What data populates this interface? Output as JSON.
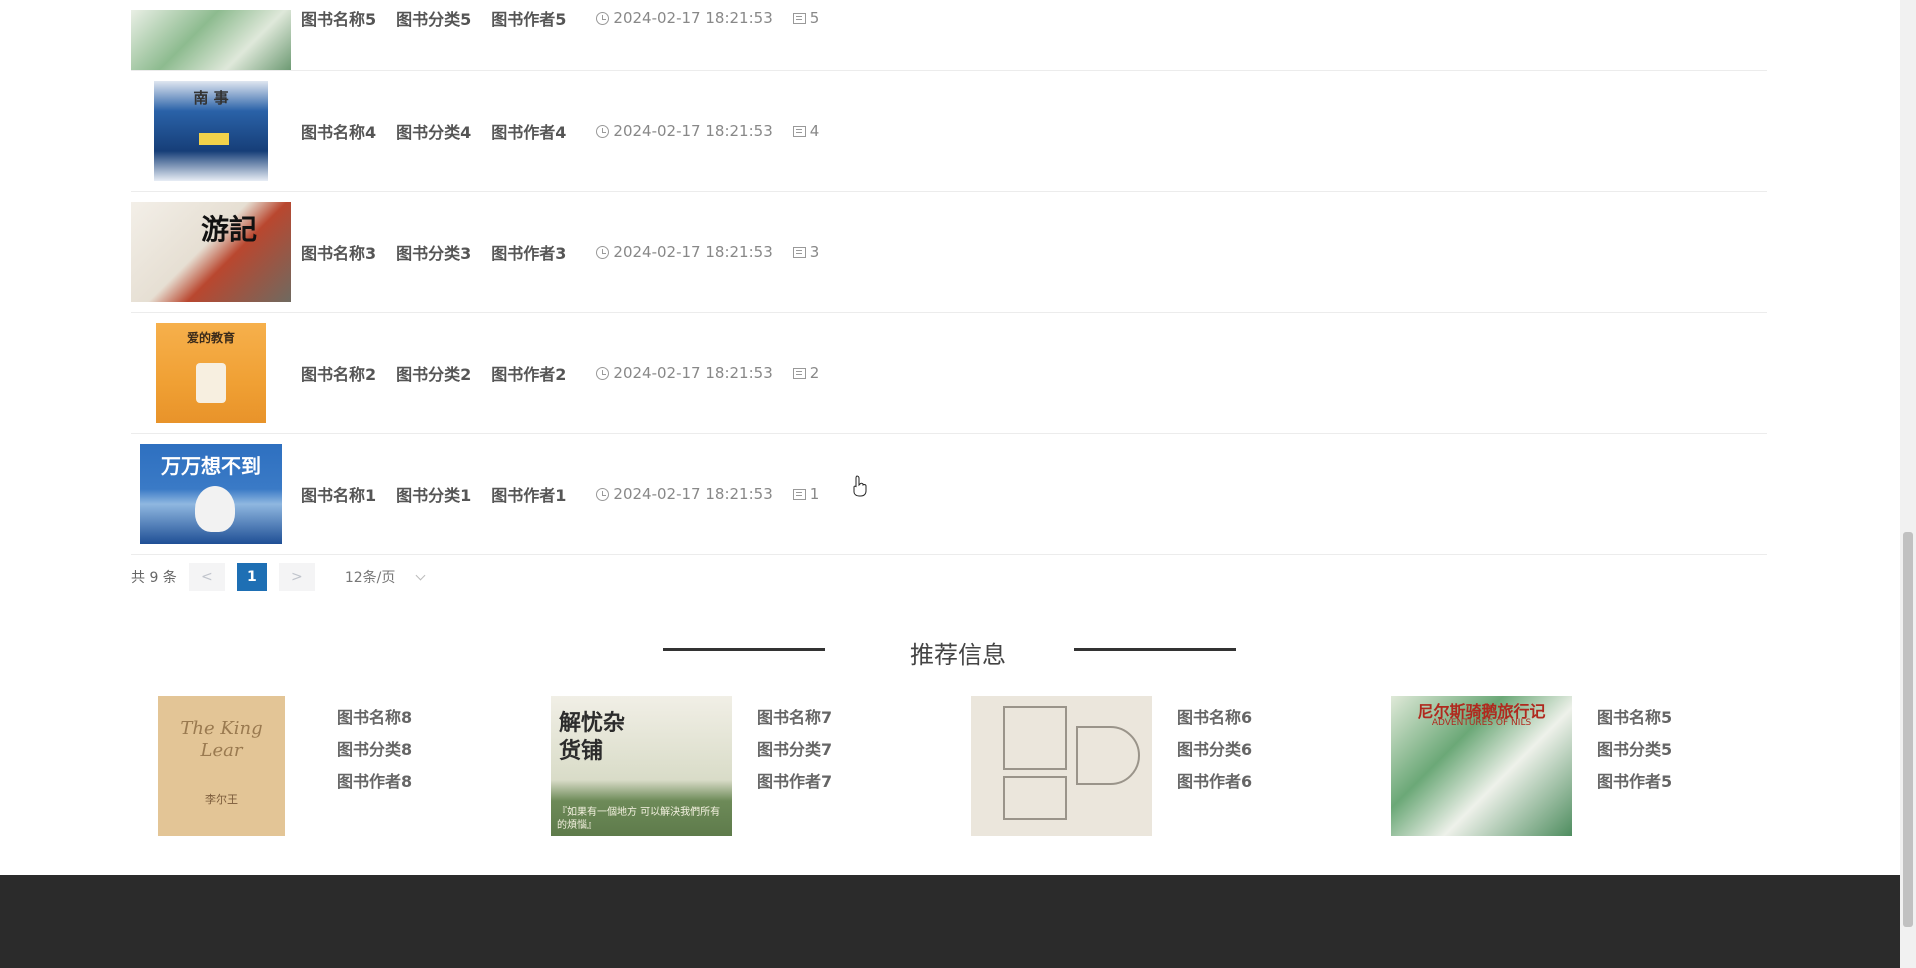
{
  "list": [
    {
      "name": "图书名称5",
      "category": "图书分类5",
      "author": "图书作者5",
      "time": "2024-02-17 18:21:53",
      "count": "5",
      "cover_text": "",
      "cover_color": "#6ea37a"
    },
    {
      "name": "图书名称4",
      "category": "图书分类4",
      "author": "图书作者4",
      "time": "2024-02-17 18:21:53",
      "count": "4",
      "cover_text": "南 事",
      "cover_color": "#1c4f8f"
    },
    {
      "name": "图书名称3",
      "category": "图书分类3",
      "author": "图书作者3",
      "time": "2024-02-17 18:21:53",
      "count": "3",
      "cover_text": "游記",
      "cover_color": "#e8e4dc"
    },
    {
      "name": "图书名称2",
      "category": "图书分类2",
      "author": "图书作者2",
      "time": "2024-02-17 18:21:53",
      "count": "2",
      "cover_text": "爱的教育",
      "cover_color": "#f0a63c"
    },
    {
      "name": "图书名称1",
      "category": "图书分类1",
      "author": "图书作者1",
      "time": "2024-02-17 18:21:53",
      "count": "1",
      "cover_text": "万万想不到",
      "cover_color": "#2d6cb8"
    }
  ],
  "pager": {
    "total": "共 9 条",
    "prev": "<",
    "current": "1",
    "next": ">",
    "page_size": "12条/页"
  },
  "recommend": {
    "title": "推荐信息",
    "items": [
      {
        "name": "图书名称8",
        "category": "图书分类8",
        "author": "图书作者8",
        "cover_text": "The King Lear",
        "cover_sub": "李尔王",
        "cover_color": "#e6c89a"
      },
      {
        "name": "图书名称7",
        "category": "图书分类7",
        "author": "图书作者7",
        "cover_text": "解忧杂货铺",
        "cover_sub": "『如果有一個地方 可以解決我們所有的煩惱』",
        "cover_color": "#cfd9c0"
      },
      {
        "name": "图书名称6",
        "category": "图书分类6",
        "author": "图书作者6",
        "cover_text": "",
        "cover_sub": "",
        "cover_color": "#ece7df"
      },
      {
        "name": "图书名称5",
        "category": "图书分类5",
        "author": "图书作者5",
        "cover_text": "尼尔斯骑鹅旅行记",
        "cover_sub": "ADVENTURES OF NILS",
        "cover_color": "#5fa06e"
      }
    ]
  },
  "colors": {
    "accent": "#1e6fb4",
    "footer": "#2b2b2b"
  }
}
